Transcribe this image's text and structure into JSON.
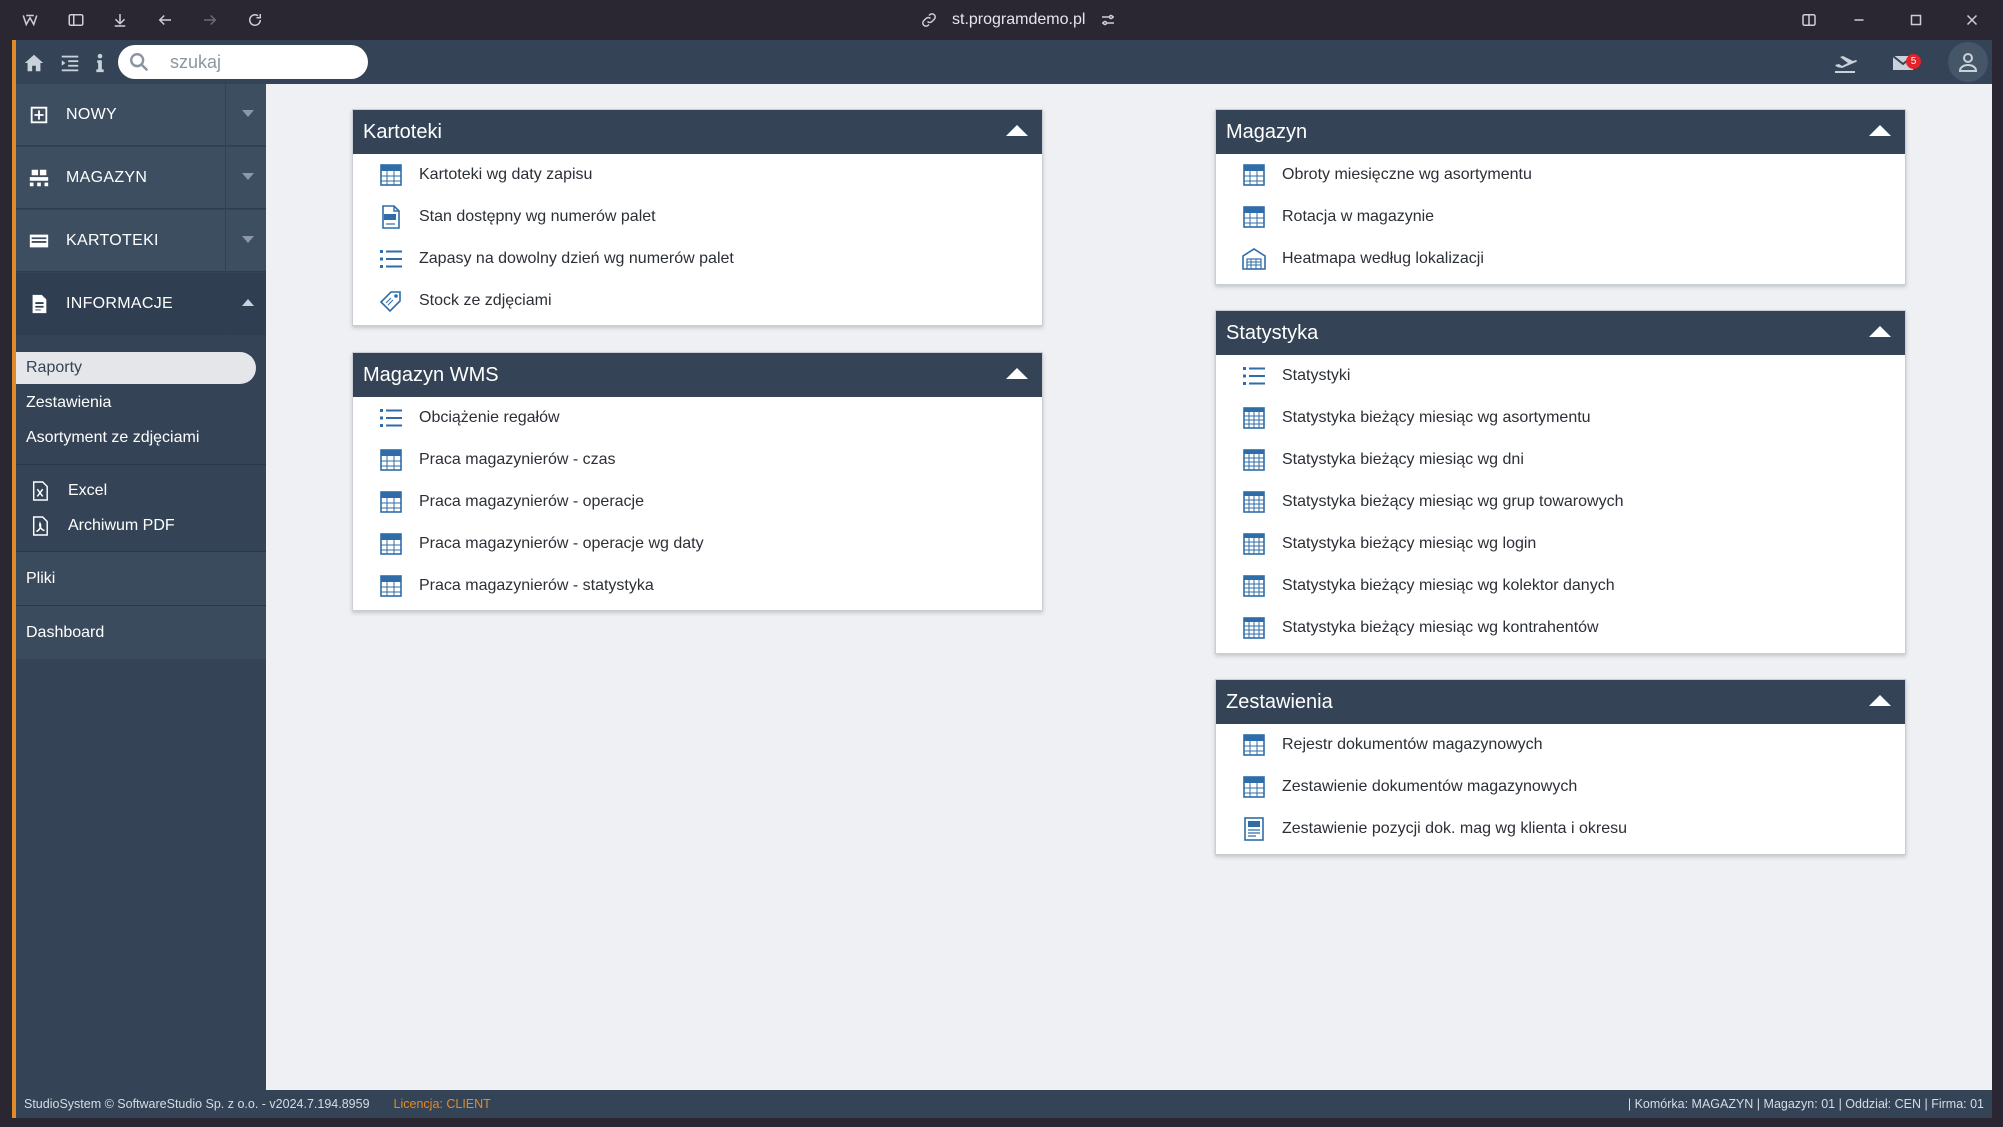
{
  "browser": {
    "url": "st.programdemo.pl"
  },
  "topbar": {
    "search_placeholder": "szukaj",
    "mail_badge": "5"
  },
  "sidebar": {
    "groups": [
      {
        "label": "NOWY",
        "icon": "plus-square-icon"
      },
      {
        "label": "MAGAZYN",
        "icon": "pallet-icon"
      },
      {
        "label": "KARTOTEKI",
        "icon": "card-list-icon"
      },
      {
        "label": "INFORMACJE",
        "icon": "document-icon"
      }
    ],
    "info_items": [
      "Raporty",
      "Zestawienia",
      "Asortyment ze zdjęciami"
    ],
    "file_items": [
      "Excel",
      "Archiwum PDF"
    ],
    "pliki": "Pliki",
    "dashboard": "Dashboard"
  },
  "panels": {
    "kartoteki": {
      "title": "Kartoteki",
      "items": [
        {
          "label": "Kartoteki wg daty zapisu",
          "icon": "xls-icon"
        },
        {
          "label": "Stan dostępny wg numerów palet",
          "icon": "pdf-icon"
        },
        {
          "label": "Zapasy na dowolny dzień wg numerów palet",
          "icon": "list-icon"
        },
        {
          "label": "Stock ze zdjęciami",
          "icon": "tag-icon"
        }
      ]
    },
    "magazyn_wms": {
      "title": "Magazyn WMS",
      "items": [
        {
          "label": "Obciążenie regałów",
          "icon": "list-icon"
        },
        {
          "label": "Praca magazynierów - czas",
          "icon": "xls-icon"
        },
        {
          "label": "Praca magazynierów - operacje",
          "icon": "xls-icon"
        },
        {
          "label": "Praca magazynierów - operacje wg daty",
          "icon": "xls-icon"
        },
        {
          "label": "Praca magazynierów - statystyka",
          "icon": "xls-icon"
        }
      ]
    },
    "magazyn": {
      "title": "Magazyn",
      "items": [
        {
          "label": "Obroty miesięczne wg asortymentu",
          "icon": "xls-icon"
        },
        {
          "label": "Rotacja w magazynie",
          "icon": "xls-icon"
        },
        {
          "label": "Heatmapa według lokalizacji",
          "icon": "warehouse-icon"
        }
      ]
    },
    "statystyka": {
      "title": "Statystyka",
      "items": [
        {
          "label": "Statystyki",
          "icon": "list-icon"
        },
        {
          "label": "Statystyka bieżący miesiąc wg asortymentu",
          "icon": "table-icon"
        },
        {
          "label": "Statystyka bieżący miesiąc wg dni",
          "icon": "table-icon"
        },
        {
          "label": "Statystyka bieżący miesiąc wg grup towarowych",
          "icon": "table-icon"
        },
        {
          "label": "Statystyka bieżący miesiąc wg login",
          "icon": "table-icon"
        },
        {
          "label": "Statystyka bieżący miesiąc wg kolektor danych",
          "icon": "table-icon"
        },
        {
          "label": "Statystyka bieżący miesiąc wg kontrahentów",
          "icon": "table-icon"
        }
      ]
    },
    "zestawienia": {
      "title": "Zestawienia",
      "items": [
        {
          "label": "Rejestr dokumentów magazynowych",
          "icon": "xls-icon"
        },
        {
          "label": "Zestawienie dokumentów magazynowych",
          "icon": "xls-icon"
        },
        {
          "label": "Zestawienie pozycji dok. mag wg klienta i okresu",
          "icon": "report-icon"
        }
      ]
    }
  },
  "footer": {
    "left": "StudioSystem © SoftwareStudio Sp. z o.o. - v2024.7.194.8959",
    "license": "Licencja: CLIENT",
    "right": "| Komórka: MAGAZYN | Magazyn: 01 | Oddział: CEN | Firma: 01"
  },
  "colors": {
    "header_dark": "#344456",
    "accent_orange": "#e08b2a",
    "badge_red": "#e2232a",
    "icon_blue": "#2f6da8"
  }
}
